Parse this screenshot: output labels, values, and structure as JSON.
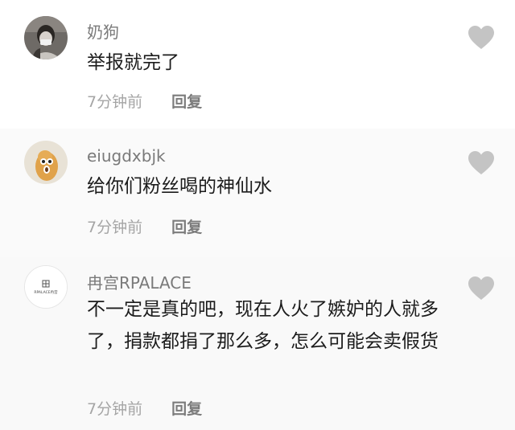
{
  "comments": [
    {
      "username": "奶狗",
      "text": "举报就完了",
      "time": "7分钟前",
      "reply": "回复",
      "avatar_icon": "person-with-mask-avatar"
    },
    {
      "username": "eiugdxbjk",
      "text": "给你们粉丝喝的神仙水",
      "time": "7分钟前",
      "reply": "回复",
      "avatar_icon": "cartoon-peanut-avatar"
    },
    {
      "username": "冉宫RPALACE",
      "text": "不一定是真的吧，现在人火了嫉妒的人就多了，捐款都捐了那么多，怎么可能会卖假货",
      "time": "7分钟前",
      "reply": "回复",
      "avatar_icon": "rpalace-logo-avatar",
      "avatar_text": "RPALACE冉宫"
    }
  ],
  "colors": {
    "username": "#7a7a7a",
    "text": "#1c1c1c",
    "time": "#a5a5a5",
    "reply": "#7c7c7c",
    "like_icon": "#c4c4c4"
  }
}
